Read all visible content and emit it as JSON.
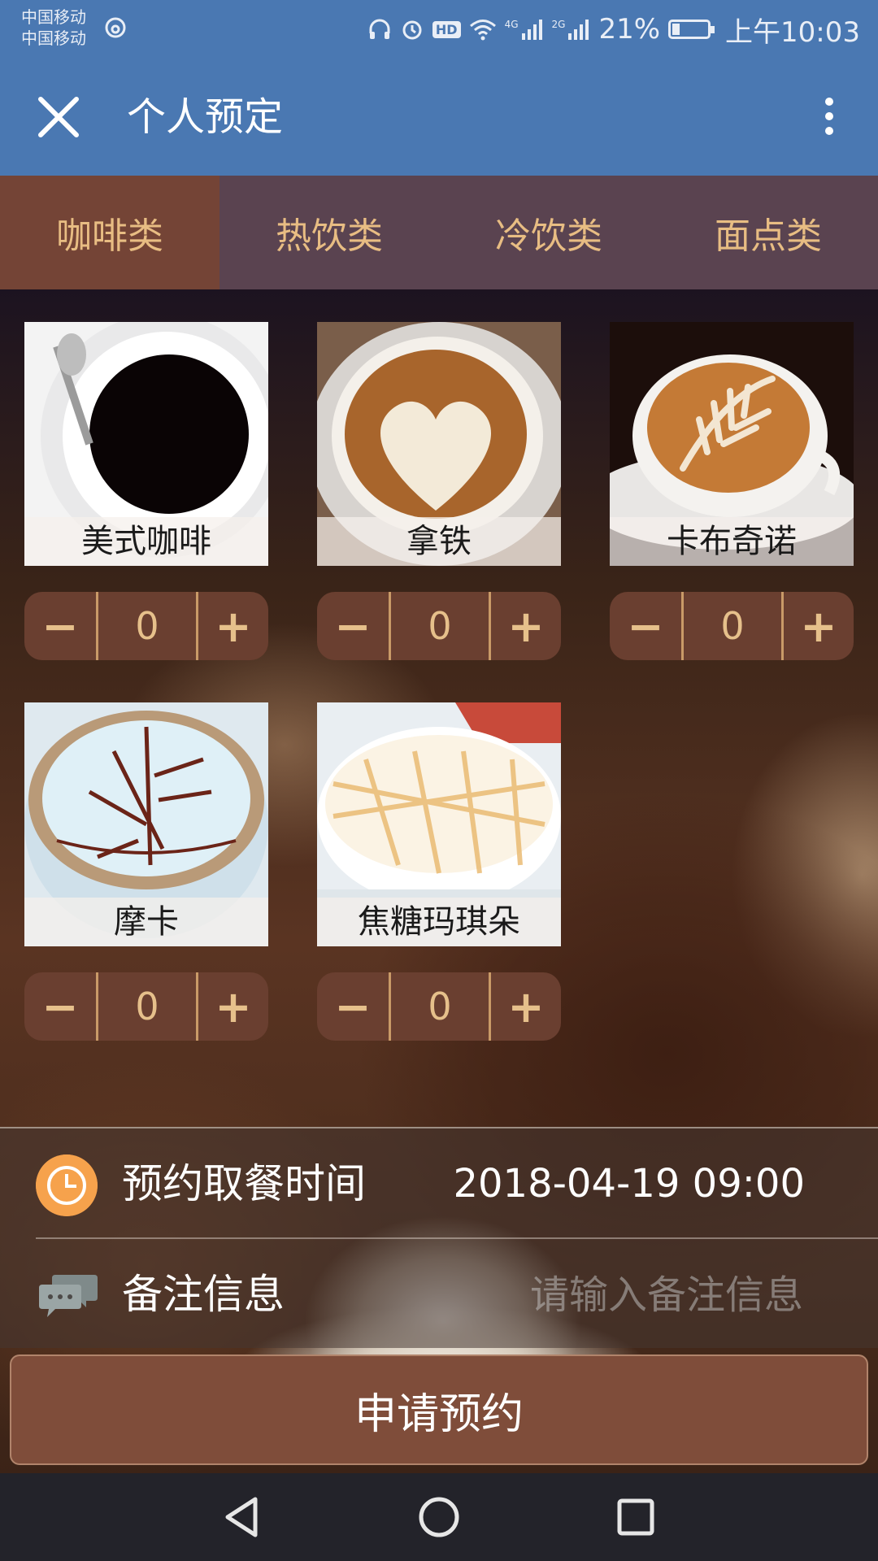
{
  "status_bar": {
    "carrier_1": "中国移动",
    "carrier_2": "中国移动",
    "hd": "HD",
    "net_1": "4G",
    "net_2": "2G",
    "battery_percent": "21%",
    "battery_level": 0.21,
    "time": "上午10:03"
  },
  "title_bar": {
    "title": "个人预定",
    "close_icon": "close-icon",
    "more_icon": "more-vertical-icon"
  },
  "tabs": [
    {
      "label": "咖啡类",
      "active": true
    },
    {
      "label": "热饮类",
      "active": false
    },
    {
      "label": "冷饮类",
      "active": false
    },
    {
      "label": "面点类",
      "active": false
    }
  ],
  "products": [
    {
      "name": "美式咖啡",
      "qty": "0"
    },
    {
      "name": "拿铁",
      "qty": "0"
    },
    {
      "name": "卡布奇诺",
      "qty": "0"
    },
    {
      "name": "摩卡",
      "qty": "0"
    },
    {
      "name": "焦糖玛琪朵",
      "qty": "0"
    }
  ],
  "stepper": {
    "minus": "−",
    "plus": "+"
  },
  "form": {
    "time_label": "预约取餐时间",
    "time_value": "2018-04-19 09:00",
    "note_label": "备注信息",
    "note_value": "",
    "note_placeholder": "请输入备注信息"
  },
  "submit_label": "申请预约",
  "colors": {
    "header": "#4a78b2",
    "tab_bar": "#5a4350",
    "tab_active": "#744436",
    "accent_text": "#e8bd83",
    "stepper": "#6a3f30",
    "clock_icon": "#f6a24c",
    "submit": "#7f4d3a"
  }
}
